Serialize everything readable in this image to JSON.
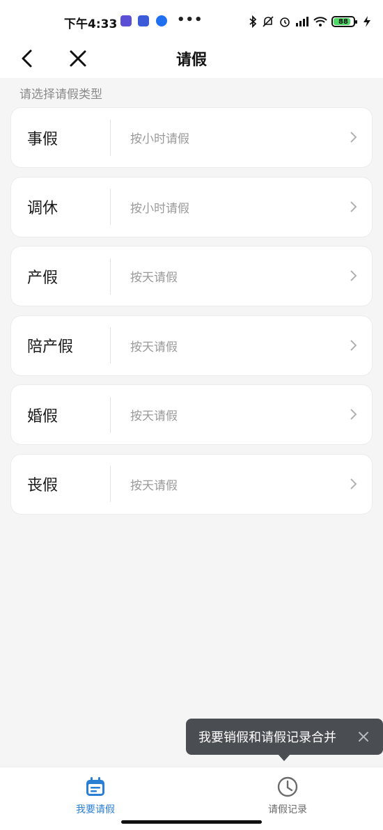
{
  "status_bar": {
    "time": "下午4:33",
    "battery_level": "88",
    "battery_fraction": 0.88,
    "left_icons": [
      "app-badge-icon",
      "app-badge-icon",
      "app-badge-icon",
      "more-dots-icon"
    ],
    "right_icons": [
      "bluetooth-icon",
      "mute-icon",
      "alarm-icon",
      "signal-icon",
      "wifi-icon",
      "battery-icon",
      "charging-icon"
    ]
  },
  "navbar": {
    "title": "请假",
    "back_icon": "chevron-left-icon",
    "close_icon": "close-icon"
  },
  "section_hint": "请选择请假类型",
  "leave_types": [
    {
      "name": "事假",
      "unit": "按小时请假"
    },
    {
      "name": "调休",
      "unit": "按小时请假"
    },
    {
      "name": "产假",
      "unit": "按天请假"
    },
    {
      "name": "陪产假",
      "unit": "按天请假"
    },
    {
      "name": "婚假",
      "unit": "按天请假"
    },
    {
      "name": "丧假",
      "unit": "按天请假"
    }
  ],
  "tooltip": {
    "text": "我要销假和请假记录合并",
    "close_icon": "close-icon"
  },
  "tabs": [
    {
      "label": "我要请假",
      "icon": "calendar-icon",
      "active": true
    },
    {
      "label": "请假记录",
      "icon": "clock-icon",
      "active": false
    }
  ],
  "colors": {
    "accent": "#2a7fd4",
    "background": "#f5f5f5",
    "card": "#ffffff",
    "tooltip_bg": "#4a4d52",
    "battery_fill": "#4cd964"
  }
}
